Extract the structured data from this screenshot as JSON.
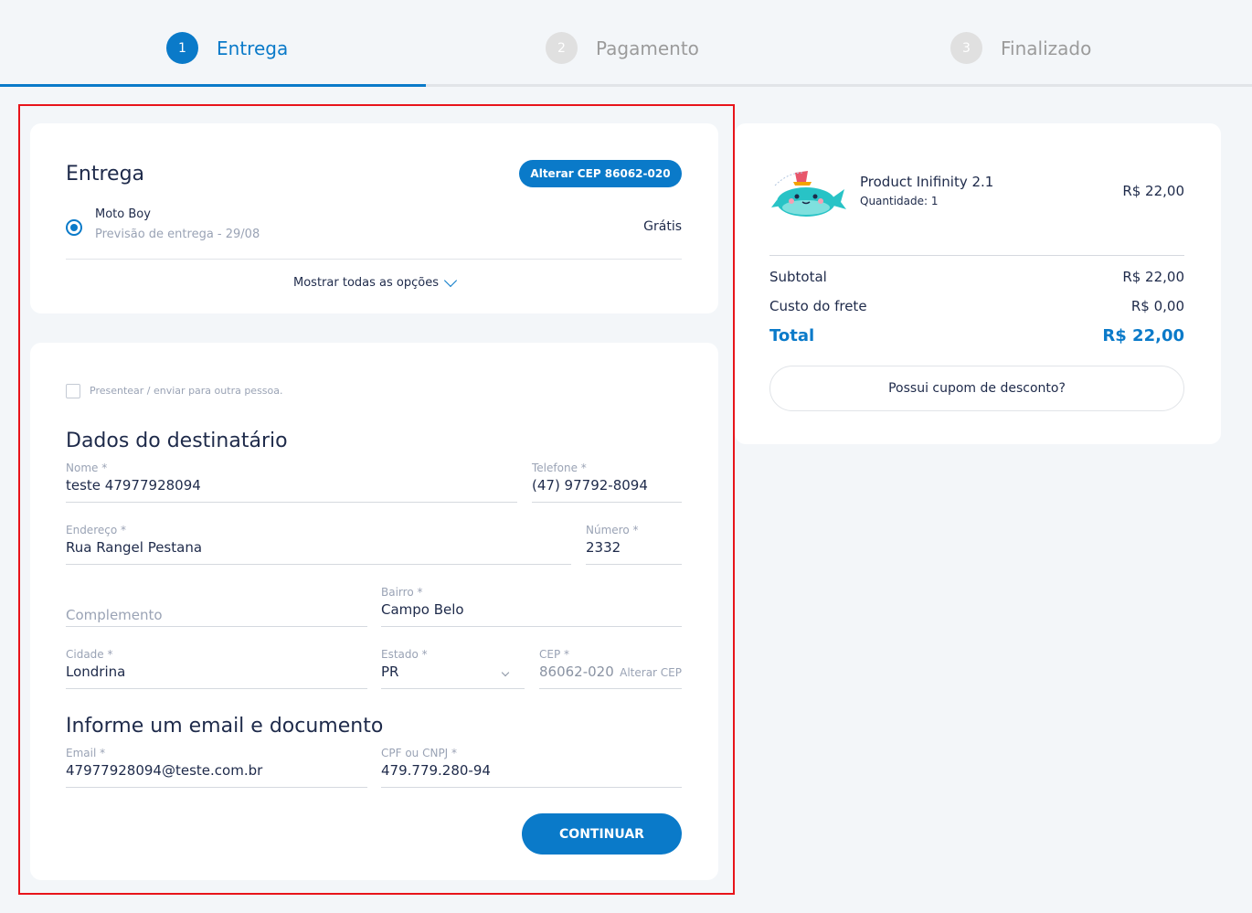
{
  "stepper": {
    "steps": [
      {
        "number": "1",
        "label": "Entrega",
        "active": true
      },
      {
        "number": "2",
        "label": "Pagamento",
        "active": false
      },
      {
        "number": "3",
        "label": "Finalizado",
        "active": false
      }
    ]
  },
  "shipping": {
    "title": "Entrega",
    "change_cep_label": "Alterar CEP 86062-020",
    "option": {
      "name": "Moto Boy",
      "eta": "Previsão de entrega - 29/08",
      "price": "Grátis"
    },
    "show_all_label": "Mostrar todas as opções"
  },
  "form": {
    "gift_label": "Presentear / enviar para outra pessoa.",
    "recipient_title": "Dados do destinatário",
    "fields": {
      "nome": {
        "label": "Nome *",
        "value": "teste 47977928094"
      },
      "telefone": {
        "label": "Telefone *",
        "value": "(47) 97792-8094"
      },
      "endereco": {
        "label": "Endereço *",
        "value": "Rua Rangel Pestana"
      },
      "numero": {
        "label": "Número *",
        "value": "2332"
      },
      "complemento": {
        "placeholder": "Complemento"
      },
      "bairro": {
        "label": "Bairro *",
        "value": "Campo Belo"
      },
      "cidade": {
        "label": "Cidade *",
        "value": "Londrina"
      },
      "estado": {
        "label": "Estado *",
        "value": "PR"
      },
      "cep": {
        "label": "CEP *",
        "value": "86062-020",
        "action": "Alterar CEP"
      }
    },
    "contact_title": "Informe um email e documento",
    "contact_fields": {
      "email": {
        "label": "Email *",
        "value": "47977928094@teste.com.br"
      },
      "cpf": {
        "label": "CPF ou CNPJ *",
        "value": "479.779.280-94"
      }
    },
    "continue_label": "CONTINUAR"
  },
  "summary": {
    "product": {
      "name": "Product Inifinity 2.1",
      "quantity": "Quantidade: 1",
      "price": "R$ 22,00",
      "icon": "whale-icon"
    },
    "subtotal": {
      "label": "Subtotal",
      "value": "R$ 22,00"
    },
    "shipping_cost": {
      "label": "Custo do frete",
      "value": "R$ 0,00"
    },
    "total": {
      "label": "Total",
      "value": "R$ 22,00"
    },
    "coupon_label": "Possui cupom de desconto?"
  },
  "colors": {
    "accent": "#0a7ac9",
    "highlight": "#e8141b",
    "background": "#f3f6f9"
  }
}
